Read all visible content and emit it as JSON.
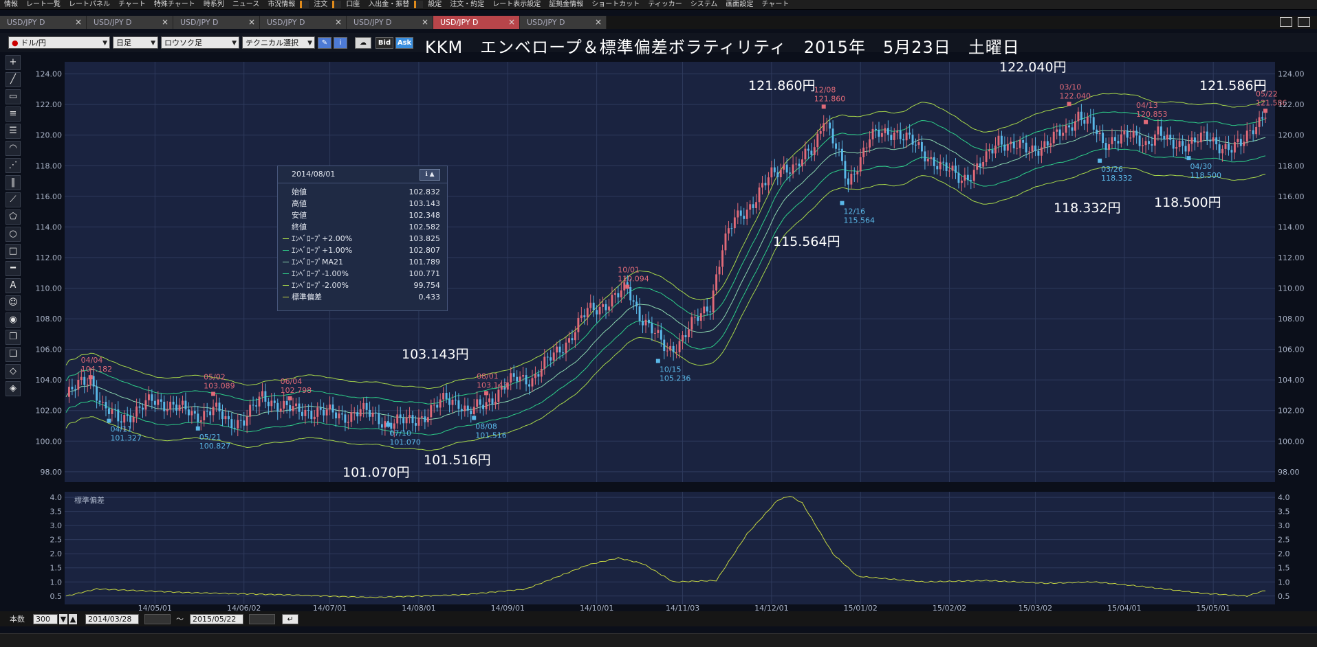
{
  "menu": [
    "情報",
    "レート一覧",
    "レートパネル",
    "チャート",
    "特殊チャート",
    "時系列",
    "ニュース",
    "市況情報",
    "注文",
    "口座",
    "入出金・振替",
    "設定",
    "注文・約定",
    "レート表示設定",
    "証拠金情報",
    "ショートカット",
    "ティッカー",
    "システム",
    "画面設定",
    "チャート"
  ],
  "tabs": [
    {
      "label": "USD/JPY D",
      "active": false
    },
    {
      "label": "USD/JPY D",
      "active": false
    },
    {
      "label": "USD/JPY D",
      "active": false
    },
    {
      "label": "USD/JPY D",
      "active": false
    },
    {
      "label": "USD/JPY D",
      "active": false
    },
    {
      "label": "USD/JPY D",
      "active": true
    },
    {
      "label": "USD/JPY D",
      "active": false
    }
  ],
  "toolbar": {
    "pair": "ドル/円",
    "period": "日足",
    "chart_type": "ロウソク足",
    "technical": "テクニカル選択",
    "bid": "Bid",
    "ask": "Ask",
    "title": "KKM　エンベロープ＆標準偏差ボラティリティ　2015年　5月23日　土曜日"
  },
  "info_panel": {
    "date": "2014/08/01",
    "rows": [
      {
        "label": "始値",
        "value": "102.832",
        "color": ""
      },
      {
        "label": "高値",
        "value": "103.143",
        "color": ""
      },
      {
        "label": "安値",
        "value": "102.348",
        "color": ""
      },
      {
        "label": "終値",
        "value": "102.582",
        "color": ""
      },
      {
        "label": "ｴﾝﾍﾞﾛｰﾌﾟ+2.00%",
        "value": "103.825",
        "color": "#a8d84a"
      },
      {
        "label": "ｴﾝﾍﾞﾛｰﾌﾟ+1.00%",
        "value": "102.807",
        "color": "#2ed08a"
      },
      {
        "label": "ｴﾝﾍﾞﾛｰﾌﾟMA21",
        "value": "101.789",
        "color": "#8cd8b0"
      },
      {
        "label": "ｴﾝﾍﾞﾛｰﾌﾟ-1.00%",
        "value": "100.771",
        "color": "#2ed08a"
      },
      {
        "label": "ｴﾝﾍﾞﾛｰﾌﾟ-2.00%",
        "value": "99.754",
        "color": "#a8d84a"
      },
      {
        "label": "標準偏差",
        "value": "0.433",
        "color": "#c8d840"
      }
    ]
  },
  "big_notes": [
    {
      "text": "121.860円",
      "x": 1088,
      "y": 110
    },
    {
      "text": "122.040円",
      "x": 1453,
      "y": 83
    },
    {
      "text": "121.586円",
      "x": 1744,
      "y": 110
    },
    {
      "text": "115.564円",
      "x": 1124,
      "y": 337
    },
    {
      "text": "118.332円",
      "x": 1532,
      "y": 288
    },
    {
      "text": "118.500円",
      "x": 1678,
      "y": 280
    },
    {
      "text": "103.143円",
      "x": 584,
      "y": 501
    },
    {
      "text": "101.516円",
      "x": 616,
      "y": 655
    },
    {
      "text": "101.070円",
      "x": 498,
      "y": 673
    }
  ],
  "status": {
    "count_label": "本数",
    "count": "300",
    "from": "2014/03/28",
    "tilde": "〜",
    "to": "2015/05/22"
  },
  "chart_data": {
    "type": "candlestick",
    "ylim": [
      97.5,
      124.7
    ],
    "y_ticks": [
      "124.00",
      "122.00",
      "120.00",
      "118.00",
      "116.00",
      "114.00",
      "112.00",
      "110.00",
      "108.00",
      "106.00",
      "104.00",
      "102.00",
      "100.00",
      "98.00"
    ],
    "x_ticks": [
      "14/05/01",
      "14/06/02",
      "14/07/01",
      "14/08/01",
      "14/09/01",
      "14/10/01",
      "14/11/03",
      "14/12/01",
      "15/01/02",
      "15/02/02",
      "15/03/02",
      "15/04/01",
      "15/05/01"
    ],
    "close_path": [
      [
        0,
        102.9
      ],
      [
        5,
        103.8
      ],
      [
        8,
        104.18
      ],
      [
        12,
        102.2
      ],
      [
        17,
        101.4
      ],
      [
        22,
        101.9
      ],
      [
        28,
        102.6
      ],
      [
        35,
        102.4
      ],
      [
        42,
        101.6
      ],
      [
        48,
        102.2
      ],
      [
        53,
        101.1
      ],
      [
        58,
        101.5
      ],
      [
        64,
        102.8
      ],
      [
        70,
        102.4
      ],
      [
        75,
        101.9
      ],
      [
        82,
        102.0
      ],
      [
        90,
        101.6
      ],
      [
        96,
        102.0
      ],
      [
        105,
        101.2
      ],
      [
        112,
        101.3
      ],
      [
        118,
        101.8
      ],
      [
        124,
        102.8
      ],
      [
        128,
        102.6
      ],
      [
        131,
        101.8
      ],
      [
        137,
        102.5
      ],
      [
        143,
        103.6
      ],
      [
        147,
        104.1
      ],
      [
        152,
        104.1
      ],
      [
        158,
        105.4
      ],
      [
        164,
        106.7
      ],
      [
        170,
        108.5
      ],
      [
        176,
        109.0
      ],
      [
        180,
        109.5
      ],
      [
        183,
        110.0
      ],
      [
        187,
        108.3
      ],
      [
        191,
        107.2
      ],
      [
        196,
        105.9
      ],
      [
        200,
        106.5
      ],
      [
        205,
        107.8
      ],
      [
        210,
        109.0
      ],
      [
        214,
        112.6
      ],
      [
        218,
        114.5
      ],
      [
        224,
        115.6
      ],
      [
        230,
        117.4
      ],
      [
        234,
        118.0
      ],
      [
        238,
        117.8
      ],
      [
        244,
        119.3
      ],
      [
        247,
        121.3
      ],
      [
        250,
        119.6
      ],
      [
        253,
        118.0
      ],
      [
        255,
        116.8
      ],
      [
        258,
        118.2
      ],
      [
        262,
        119.8
      ],
      [
        266,
        120.1
      ],
      [
        270,
        120.3
      ],
      [
        275,
        119.6
      ],
      [
        280,
        118.8
      ],
      [
        286,
        117.8
      ],
      [
        292,
        117.2
      ],
      [
        296,
        117.6
      ],
      [
        300,
        118.4
      ],
      [
        304,
        119.8
      ],
      [
        308,
        119.3
      ],
      [
        314,
        119.0
      ],
      [
        320,
        119.5
      ],
      [
        326,
        120.3
      ],
      [
        330,
        121.4
      ],
      [
        334,
        120.7
      ],
      [
        338,
        119.4
      ],
      [
        342,
        119.9
      ],
      [
        348,
        119.8
      ],
      [
        352,
        119.5
      ],
      [
        356,
        120.2
      ],
      [
        360,
        119.3
      ],
      [
        364,
        119.5
      ],
      [
        368,
        119.6
      ],
      [
        372,
        119.8
      ],
      [
        376,
        119.4
      ],
      [
        380,
        119.1
      ],
      [
        383,
        119.3
      ],
      [
        387,
        120.6
      ],
      [
        391,
        121.5
      ]
    ],
    "high_labels": [
      {
        "date": "04/04",
        "value": "104.182",
        "i": 8,
        "y": 104.18
      },
      {
        "date": "05/02",
        "value": "103.089",
        "i": 48,
        "y": 103.09
      },
      {
        "date": "06/04",
        "value": "102.798",
        "i": 73,
        "y": 102.8
      },
      {
        "date": "08/01",
        "value": "103.143",
        "i": 137,
        "y": 103.14
      },
      {
        "date": "10/01",
        "value": "110.094",
        "i": 183,
        "y": 110.09
      },
      {
        "date": "12/08",
        "value": "121.860",
        "i": 247,
        "y": 121.86
      },
      {
        "date": "03/10",
        "value": "122.040",
        "i": 327,
        "y": 122.04
      },
      {
        "date": "04/13",
        "value": "120.853",
        "i": 352,
        "y": 120.85
      },
      {
        "date": "05/22",
        "value": "121.586",
        "i": 391,
        "y": 121.59
      }
    ],
    "low_labels": [
      {
        "date": "04/11",
        "value": "101.327",
        "i": 14,
        "y": 101.33
      },
      {
        "date": "05/21",
        "value": "100.827",
        "i": 43,
        "y": 100.83
      },
      {
        "date": "07/10",
        "value": "101.070",
        "i": 105,
        "y": 101.07
      },
      {
        "date": "08/08",
        "value": "101.516",
        "i": 133,
        "y": 101.52
      },
      {
        "date": "10/15",
        "value": "105.236",
        "i": 193,
        "y": 105.24
      },
      {
        "date": "12/16",
        "value": "115.564",
        "i": 253,
        "y": 115.56
      },
      {
        "date": "03/26",
        "value": "118.332",
        "i": 337,
        "y": 118.33
      },
      {
        "date": "04/30",
        "value": "118.500",
        "i": 366,
        "y": 118.5
      }
    ],
    "sd_panel": {
      "label": "標準偏差",
      "ylim": [
        0.3,
        4.1
      ],
      "y_ticks": [
        "4.0",
        "3.5",
        "3.0",
        "2.5",
        "2.0",
        "1.5",
        "1.0",
        "0.5"
      ],
      "path": [
        [
          0,
          0.5
        ],
        [
          10,
          0.75
        ],
        [
          40,
          0.62
        ],
        [
          70,
          0.55
        ],
        [
          100,
          0.45
        ],
        [
          130,
          0.55
        ],
        [
          150,
          0.75
        ],
        [
          170,
          1.6
        ],
        [
          180,
          1.85
        ],
        [
          188,
          1.65
        ],
        [
          198,
          1.0
        ],
        [
          212,
          1.05
        ],
        [
          222,
          2.7
        ],
        [
          232,
          3.9
        ],
        [
          236,
          4.05
        ],
        [
          240,
          3.8
        ],
        [
          250,
          2.0
        ],
        [
          258,
          1.2
        ],
        [
          280,
          1.0
        ],
        [
          300,
          1.05
        ],
        [
          320,
          0.95
        ],
        [
          335,
          1.0
        ],
        [
          350,
          0.85
        ],
        [
          370,
          0.6
        ],
        [
          385,
          0.5
        ],
        [
          391,
          0.7
        ]
      ]
    }
  }
}
